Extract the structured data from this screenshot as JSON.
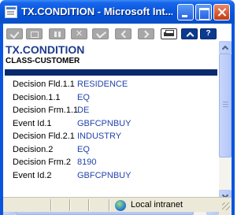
{
  "window": {
    "title": "TX.CONDITION - Microsoft Int..."
  },
  "toolbar": {
    "buttons": [
      "check-icon",
      "edit-icon",
      "pause-icon",
      "x-icon",
      "check2-icon",
      "prev-icon",
      "next-icon",
      "print-icon",
      "up-icon",
      "help-icon"
    ],
    "help_label": "?"
  },
  "page": {
    "title": "TX.CONDITION",
    "subtitle": "CLASS-CUSTOMER",
    "header_bar_color": "#0b2a6e",
    "label_color": "#000000",
    "value_color": "#2244aa"
  },
  "fields": [
    {
      "label": "Decision Fld.1.1",
      "value": "RESIDENCE"
    },
    {
      "label": "Decision.1.1",
      "value": "EQ"
    },
    {
      "label": "Decision Frm.1.1",
      "value": "DE"
    },
    {
      "label": "Event Id.1",
      "value": "GBFCPNBUY"
    },
    {
      "label": "Decision Fld.2.1",
      "value": "INDUSTRY"
    },
    {
      "label": "Decision.2",
      "value": "EQ"
    },
    {
      "label": "Decision Frm.2",
      "value": "8190"
    },
    {
      "label": "Event Id.2",
      "value": "GBFCPNBUY"
    }
  ],
  "statusbar": {
    "zone_icon": "globe-icon",
    "zone_text": "Local intranet"
  }
}
